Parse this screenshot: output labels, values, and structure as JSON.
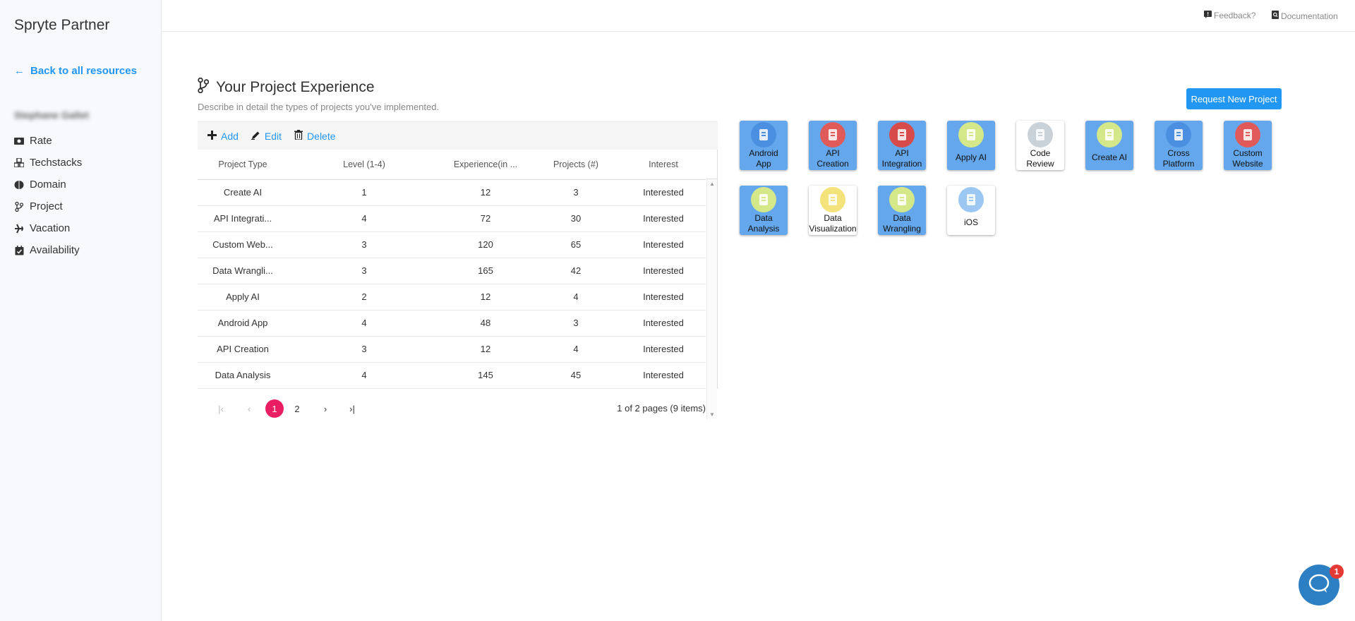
{
  "app": {
    "brand": "Spryte Partner"
  },
  "sidebar": {
    "back_label": "Back to all resources",
    "user_name": "Stephane Gallet",
    "items": [
      {
        "label": "Rate",
        "icon": "money-icon"
      },
      {
        "label": "Techstacks",
        "icon": "cubes-icon"
      },
      {
        "label": "Domain",
        "icon": "brain-icon"
      },
      {
        "label": "Project",
        "icon": "branch-icon"
      },
      {
        "label": "Vacation",
        "icon": "plane-icon"
      },
      {
        "label": "Availability",
        "icon": "calendar-check-icon"
      }
    ]
  },
  "topbar": {
    "feedback": "Feedback?",
    "documentation": "Documentation"
  },
  "main": {
    "title": "Your Project Experience",
    "subtitle": "Describe in detail the types of projects you've implemented.",
    "toolbar": {
      "add": "Add",
      "edit": "Edit",
      "delete": "Delete"
    },
    "request_button": "Request New Project"
  },
  "table": {
    "headers": [
      "Project Type",
      "Level (1-4)",
      "Experience(in ...",
      "Projects (#)",
      "Interest"
    ],
    "rows": [
      [
        "Create AI",
        "1",
        "12",
        "3",
        "Interested"
      ],
      [
        "API Integrati...",
        "4",
        "72",
        "30",
        "Interested"
      ],
      [
        "Custom Web...",
        "3",
        "120",
        "65",
        "Interested"
      ],
      [
        "Data Wrangli...",
        "3",
        "165",
        "42",
        "Interested"
      ],
      [
        "Apply AI",
        "2",
        "12",
        "4",
        "Interested"
      ],
      [
        "Android App",
        "4",
        "48",
        "3",
        "Interested"
      ],
      [
        "API Creation",
        "3",
        "12",
        "4",
        "Interested"
      ],
      [
        "Data Analysis",
        "4",
        "145",
        "45",
        "Interested"
      ]
    ]
  },
  "pager": {
    "pages": [
      "1",
      "2"
    ],
    "current": "1",
    "info": "1 of 2 pages (9 items)"
  },
  "tiles": [
    {
      "label": "Android App",
      "lines": [
        "Android",
        "App"
      ],
      "style": "blue",
      "circle": "#4a8fe0"
    },
    {
      "label": "API Creation",
      "lines": [
        "API",
        "Creation"
      ],
      "style": "blue",
      "circle": "#e05a5a"
    },
    {
      "label": "API Integration",
      "lines": [
        "API",
        "Integration"
      ],
      "style": "blue",
      "circle": "#d84b4b"
    },
    {
      "label": "Apply AI",
      "lines": [
        "Apply AI"
      ],
      "style": "blue",
      "circle": "#d4e88a"
    },
    {
      "label": "Code Review",
      "lines": [
        "Code",
        "Review"
      ],
      "style": "white",
      "circle": "#c9d1d9"
    },
    {
      "label": "Create AI",
      "lines": [
        "Create AI"
      ],
      "style": "blue",
      "circle": "#d4e88a"
    },
    {
      "label": "Cross Platform",
      "lines": [
        "Cross",
        "Platform"
      ],
      "style": "blue",
      "circle": "#4a8fe0"
    },
    {
      "label": "Custom Website",
      "lines": [
        "Custom",
        "Website"
      ],
      "style": "blue",
      "circle": "#e05a5a"
    },
    {
      "label": "Data Analysis",
      "lines": [
        "Data",
        "Analysis"
      ],
      "style": "blue",
      "circle": "#d4e88a"
    },
    {
      "label": "Data Visualization",
      "lines": [
        "Data",
        "Visualization"
      ],
      "style": "white",
      "circle": "#f4e37a"
    },
    {
      "label": "Data Wrangling",
      "lines": [
        "Data",
        "Wrangling"
      ],
      "style": "blue",
      "circle": "#d4e88a"
    },
    {
      "label": "iOS",
      "lines": [
        "iOS"
      ],
      "style": "white",
      "circle": "#9cc7f2"
    }
  ],
  "chat": {
    "badge": "1"
  },
  "colors": {
    "accent": "#2196f3",
    "active_page": "#e91e63",
    "tile_blue": "#64a7ec"
  }
}
